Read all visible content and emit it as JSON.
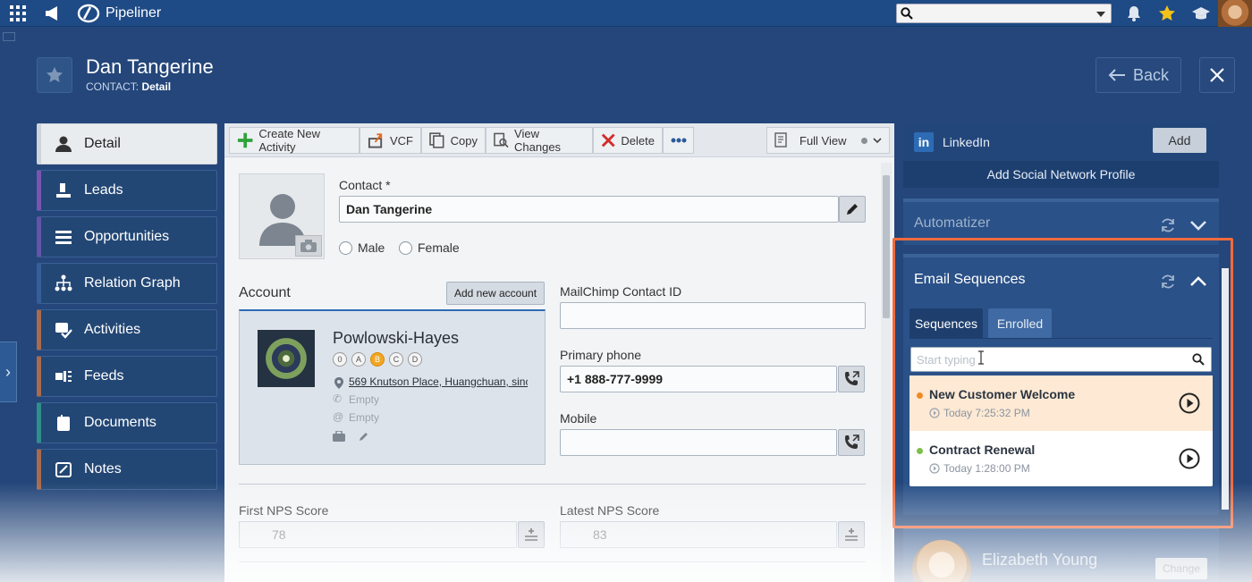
{
  "app": {
    "brand": "Pipeliner",
    "search_placeholder": ""
  },
  "icons": {
    "apps": "apps-grid-icon",
    "announce": "megaphone-icon",
    "notifications": "bell-icon",
    "favorites": "star-icon",
    "academy": "graduation-cap-icon"
  },
  "header": {
    "title": "Dan Tangerine",
    "subtitle_prefix": "CONTACT:",
    "subtitle_view": "Detail",
    "back_label": "Back"
  },
  "nav": [
    {
      "label": "Detail",
      "icon": "person-icon",
      "active": true
    },
    {
      "label": "Leads",
      "icon": "leads-icon"
    },
    {
      "label": "Opportunities",
      "icon": "opportunities-icon"
    },
    {
      "label": "Relation Graph",
      "icon": "relation-graph-icon"
    },
    {
      "label": "Activities",
      "icon": "activities-icon"
    },
    {
      "label": "Feeds",
      "icon": "feeds-icon"
    },
    {
      "label": "Documents",
      "icon": "documents-icon"
    },
    {
      "label": "Notes",
      "icon": "notes-icon"
    }
  ],
  "toolbar": {
    "create_activity": "Create New Activity",
    "vcf": "VCF",
    "copy": "Copy",
    "view_changes": "View Changes",
    "delete": "Delete",
    "full_view": "Full View"
  },
  "form": {
    "contact_label": "Contact *",
    "contact_value": "Dan Tangerine",
    "gender_male": "Male",
    "gender_female": "Female",
    "account_label": "Account",
    "add_account": "Add new account",
    "account_name": "Powlowski-Hayes",
    "ratings": [
      "0",
      "A",
      "B",
      "C",
      "D"
    ],
    "account_address": "569 Knutson Place, Huangchuan, sinc",
    "account_phone": "Empty",
    "account_email": "Empty",
    "mailchimp_label": "MailChimp Contact ID",
    "mailchimp_value": "",
    "primary_phone_label": "Primary phone",
    "primary_phone_value": "+1 888-777-9999",
    "mobile_label": "Mobile",
    "mobile_value": "",
    "first_nps_label": "First NPS Score",
    "first_nps_value": "78",
    "latest_nps_label": "Latest NPS Score",
    "latest_nps_value": "83"
  },
  "right": {
    "linkedin_label": "LinkedIn",
    "add_label": "Add",
    "add_social": "Add Social Network Profile",
    "automatizer": "Automatizer",
    "email_sequences": "Email Sequences",
    "tab_sequences": "Sequences",
    "tab_enrolled": "Enrolled",
    "search_placeholder": "Start typing",
    "sequences": [
      {
        "name": "New Customer Welcome",
        "time": "Today 7:25:32 PM",
        "status_color": "#f08a24"
      },
      {
        "name": "Contract Renewal",
        "time": "Today 1:28:00 PM",
        "status_color": "#7cc04a"
      }
    ],
    "owner_name": "Elizabeth Young",
    "change_label": "Change"
  }
}
